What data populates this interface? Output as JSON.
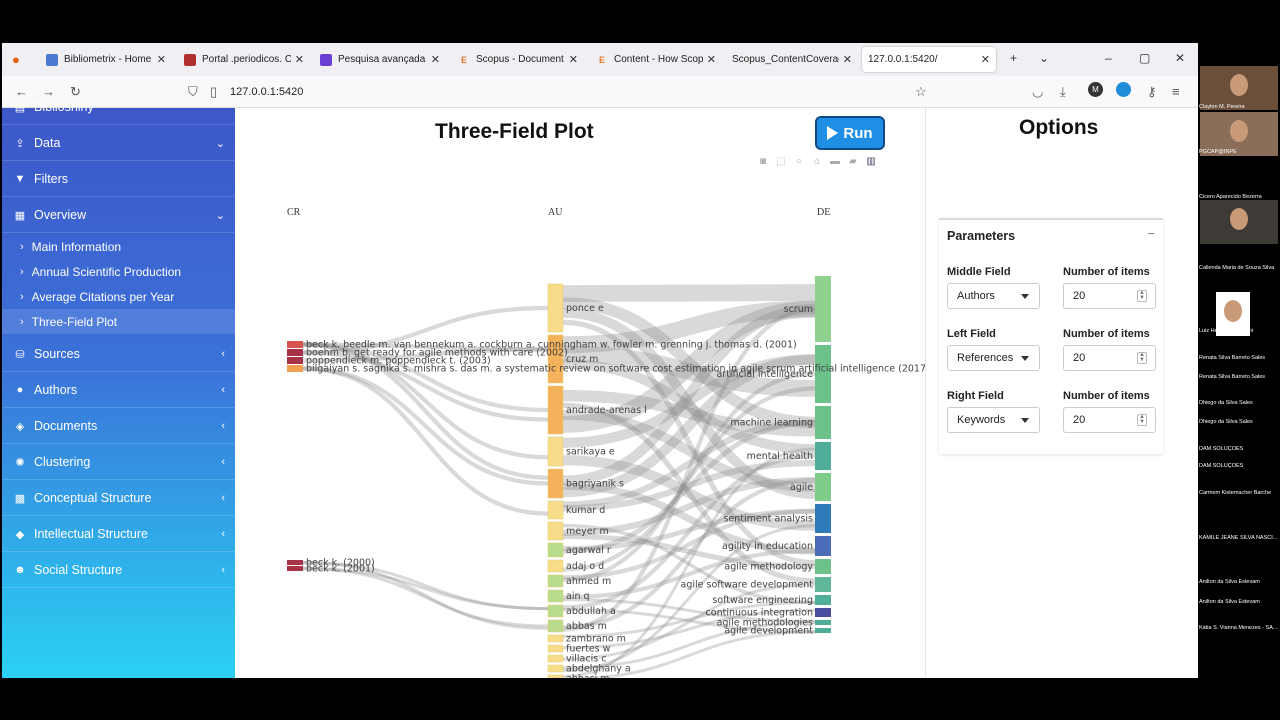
{
  "browser": {
    "tabs": [
      {
        "label": "Bibliometrix - Home",
        "icon": "globe-icon",
        "color": "#4a7bd0"
      },
      {
        "label": "Portal .periodicos. CAP",
        "icon": "capes-icon",
        "color": "#b03030"
      },
      {
        "label": "Pesquisa avançada - C",
        "icon": "search-icon",
        "color": "#6b3fd4"
      },
      {
        "label": "Scopus - Document se",
        "icon": "elsevier-icon",
        "color": "#e07b28"
      },
      {
        "label": "Content - How Scopus",
        "icon": "elsevier-icon",
        "color": "#e07b28"
      },
      {
        "label": "Scopus_ContentCoverage_",
        "icon": "none",
        "color": "#ffffff"
      },
      {
        "label": "127.0.0.1:5420/",
        "icon": "none",
        "color": "#ffffff"
      }
    ],
    "url": "127.0.0.1:5420"
  },
  "sidebar": {
    "top_partial": "Biblioshiny",
    "items": [
      {
        "label": "Data",
        "icon": "upload-icon",
        "chevron": "down"
      },
      {
        "label": "Filters",
        "icon": "filter-icon",
        "chevron": ""
      },
      {
        "label": "Overview",
        "icon": "table-icon",
        "chevron": "down"
      }
    ],
    "subitems": [
      {
        "label": "Main Information",
        "active": false
      },
      {
        "label": "Annual Scientific Production",
        "active": false
      },
      {
        "label": "Average Citations per Year",
        "active": false
      },
      {
        "label": "Three-Field Plot",
        "active": true
      }
    ],
    "items2": [
      {
        "label": "Sources",
        "icon": "database-icon"
      },
      {
        "label": "Authors",
        "icon": "user-icon"
      },
      {
        "label": "Documents",
        "icon": "layers-icon"
      },
      {
        "label": "Clustering",
        "icon": "spinner-icon"
      },
      {
        "label": "Conceptual Structure",
        "icon": "cubes-icon"
      },
      {
        "label": "Intellectual Structure",
        "icon": "gem-icon"
      },
      {
        "label": "Social Structure",
        "icon": "users-icon"
      }
    ]
  },
  "main": {
    "title": "Three-Field Plot",
    "run_label": "Run"
  },
  "chart_data": {
    "type": "sankey",
    "columns": [
      "CR",
      "AU",
      "DE"
    ],
    "left_nodes": [
      {
        "label": "beck k. beedle m. van bennekum a. cockburn a. cunningham w. fowler m. grenning j. thomas d. (2001)",
        "color": "#d9534f"
      },
      {
        "label": "boehm b. get ready for agile methods with care (2002)",
        "color": "#a83246"
      },
      {
        "label": "poppendieck m. poppendieck t. (2003)",
        "color": "#a83246"
      },
      {
        "label": "bilgaiyan s. sagnika s. mishra s. das m. a systematic review on software cost estimation in agile scrum artificial intelligence (2017)",
        "color": "#f0a050"
      },
      {
        "label": "beck k. (2000)",
        "color": "#a83246"
      },
      {
        "label": "beck k. (2001)",
        "color": "#a83246"
      }
    ],
    "middle_nodes": [
      {
        "label": "ponce e",
        "color": "#f7dc8a"
      },
      {
        "label": "cruz m",
        "color": "#f4b25a"
      },
      {
        "label": "andrade-arenas l",
        "color": "#f4b25a"
      },
      {
        "label": "sarikaya e",
        "color": "#f7dc8a"
      },
      {
        "label": "bagriyanik s",
        "color": "#f4b25a"
      },
      {
        "label": "kumar d",
        "color": "#f7dc8a"
      },
      {
        "label": "meyer m",
        "color": "#f7dc8a"
      },
      {
        "label": "agarwal r",
        "color": "#b8dc8c"
      },
      {
        "label": "adaj o d",
        "color": "#f7dc8a"
      },
      {
        "label": "ahmed m",
        "color": "#b8dc8c"
      },
      {
        "label": "ain q",
        "color": "#b8dc8c"
      },
      {
        "label": "abdullah a",
        "color": "#b8dc8c"
      },
      {
        "label": "abbas m",
        "color": "#b8dc8c"
      },
      {
        "label": "zambrano m",
        "color": "#f7dc8a"
      },
      {
        "label": "fuertes w",
        "color": "#f7dc8a"
      },
      {
        "label": "villacis c",
        "color": "#f7dc8a"
      },
      {
        "label": "abdelghany a",
        "color": "#f7dc8a"
      },
      {
        "label": "abbasi m",
        "color": "#f7dc8a"
      }
    ],
    "right_nodes": [
      {
        "label": "scrum",
        "color": "#8fd18f"
      },
      {
        "label": "artificial intelligence",
        "color": "#6cc28a"
      },
      {
        "label": "machine learning",
        "color": "#6cc28a"
      },
      {
        "label": "mental health",
        "color": "#4fae99"
      },
      {
        "label": "agile",
        "color": "#7dcc88"
      },
      {
        "label": "sentiment analysis",
        "color": "#2f7ab8"
      },
      {
        "label": "agility in education",
        "color": "#4b6cb8"
      },
      {
        "label": "agile methodology",
        "color": "#6cc28a"
      },
      {
        "label": "agile software development",
        "color": "#5fb69a"
      },
      {
        "label": "software engineering",
        "color": "#4fae99"
      },
      {
        "label": "continuous integration",
        "color": "#4b4ea0"
      },
      {
        "label": "agile methodologies",
        "color": "#4fae99"
      },
      {
        "label": "agile development",
        "color": "#4fae99"
      }
    ]
  },
  "options": {
    "title": "Options",
    "params_title": "Parameters",
    "middle_label": "Middle Field",
    "left_label": "Left Field",
    "right_label": "Right Field",
    "num_label": "Number of items",
    "middle_value": "Authors",
    "left_value": "References",
    "right_value": "Keywords",
    "middle_n": "20",
    "left_n": "20",
    "right_n": "20"
  },
  "call": {
    "participants": [
      "Clayton M. Pereira",
      "PGCAP@INPE",
      "Cicero Aparecido Bezerra",
      "Callenda Maria de Souza Silva",
      "Luiz Henrique Tacconi",
      "Renata Silva Barreto Sales",
      "Renata Silva Barreto Sales",
      "Dhiego da Silva Sales",
      "Dhiego da Silva Sales",
      "DAM SOLUÇÕES",
      "DAM SOLUÇÕES",
      "Carmem Kistemacher Barche",
      "KAMILE JEANE SILVA NASCI...",
      "Anilton da Silva Estevam",
      "Anilton da Silva Estevam",
      "Kátia S. Vianna Menezes - SA..."
    ]
  }
}
